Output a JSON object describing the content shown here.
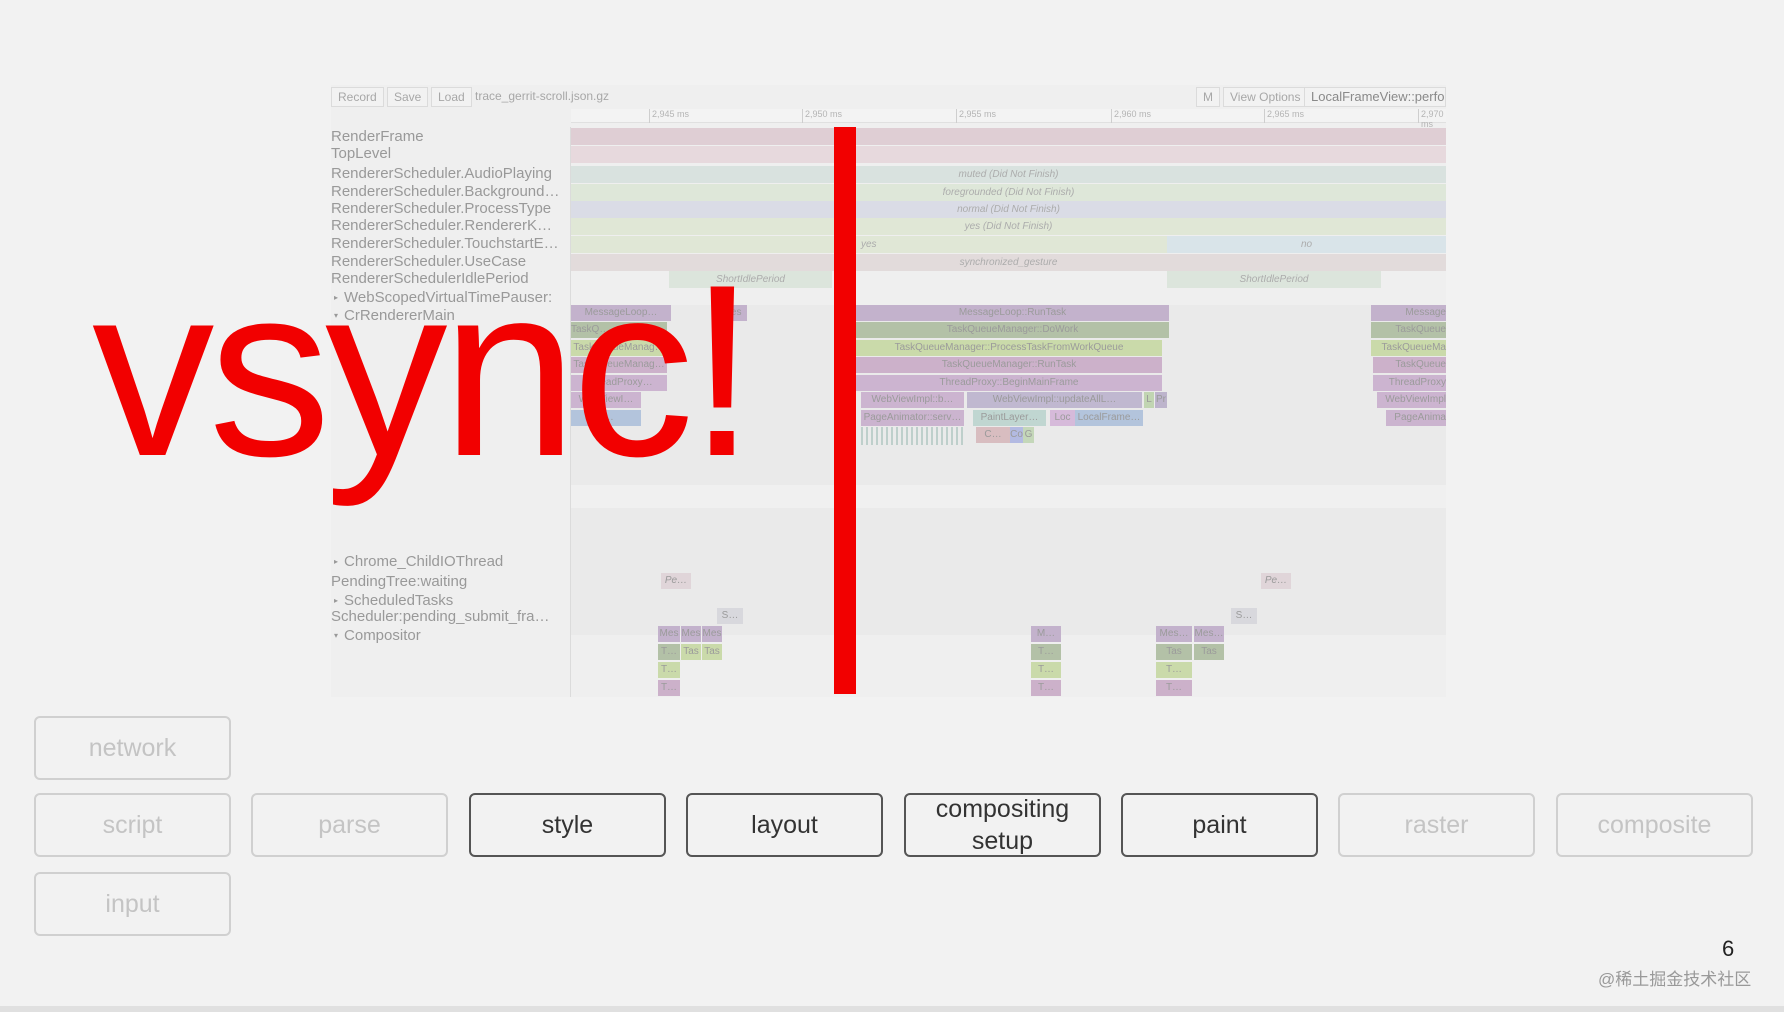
{
  "toolbar": {
    "record": "Record",
    "save": "Save",
    "load": "Load",
    "filename": "trace_gerrit-scroll.json.gz",
    "m": "M",
    "view_options": "View Options",
    "search": "LocalFrameView::perform"
  },
  "ruler": [
    "2,945 ms",
    "2,950 ms",
    "2,955 ms",
    "2,960 ms",
    "2,965 ms",
    "2,970 ms"
  ],
  "labels": [
    "RenderFrame",
    "TopLevel",
    "RendererScheduler.AudioPlaying",
    "RendererScheduler.Background…",
    "RendererScheduler.ProcessType",
    "RendererScheduler.RendererK…",
    "RendererScheduler.TouchstartE…",
    "RendererScheduler.UseCase",
    "RendererSchedulerIdlePeriod",
    "WebScopedVirtualTimePauser:",
    "CrRendererMain",
    "Chrome_ChildIOThread",
    "PendingTree:waiting",
    "ScheduledTasks",
    "Scheduler:pending_submit_fra…",
    "Compositor"
  ],
  "tracks": {
    "audio": "muted (Did Not Finish)",
    "background": "foregrounded (Did Not Finish)",
    "process": "normal (Did Not Finish)",
    "renderer": "yes (Did Not Finish)",
    "touch_yes": "yes",
    "touch_no": "no",
    "usecase": "synchronized_gesture",
    "idle1": "ShortIdlePeriod",
    "idle2": "ShortIdlePeriod"
  },
  "flame": {
    "main": [
      "MessageLoop::RunTask",
      "TaskQueueManager::DoWork",
      "TaskQueueManager::ProcessTaskFromWorkQueue",
      "TaskQueueManager::RunTask",
      "ThreadProxy::BeginMainFrame"
    ],
    "row6": [
      "WebViewImpl::b…",
      "WebViewImpl::updateAllL…",
      "L",
      "Pr"
    ],
    "row7": [
      "PageAnimator::serv…",
      "PaintLayer…",
      "Loc",
      "LocalFrame…"
    ],
    "row8": [
      "C…",
      "Co",
      "G"
    ],
    "left": [
      "MessageLoop…",
      "TaskQ…",
      "TaskQueueManag…",
      "TaskQueueManag…",
      "ThreadProxy…",
      "WebViewI…",
      "L…"
    ],
    "right": [
      "Message",
      "TaskQueue",
      "TaskQueueMa",
      "TaskQueue",
      "ThreadProxy",
      "WebViewImpl",
      "PageAnima"
    ],
    "small": [
      "Mes",
      "Pe…",
      "S…",
      "Mes…",
      "M…",
      "T…",
      "Tas"
    ]
  },
  "overlay": {
    "text": "vsync!",
    "color": "#f20000"
  },
  "buttons": [
    {
      "label": "network",
      "active": false
    },
    {
      "label": "script",
      "active": false
    },
    {
      "label": "parse",
      "active": false
    },
    {
      "label": "style",
      "active": true
    },
    {
      "label": "layout",
      "active": true
    },
    {
      "label": "compositing setup",
      "active": true
    },
    {
      "label": "paint",
      "active": true
    },
    {
      "label": "raster",
      "active": false
    },
    {
      "label": "composite",
      "active": false
    },
    {
      "label": "input",
      "active": false
    }
  ],
  "page_number": "6",
  "watermark": "@稀土掘金技术社区"
}
